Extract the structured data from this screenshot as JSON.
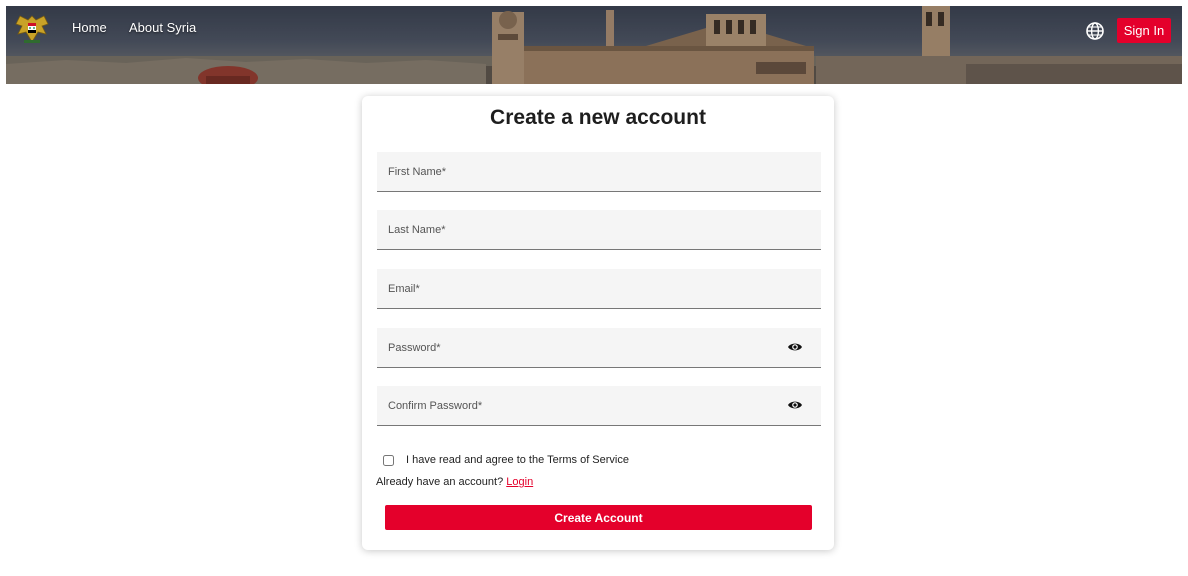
{
  "colors": {
    "accent": "#e4002b",
    "header_sky": "#4d5563",
    "field_bg": "#f5f5f5"
  },
  "header": {
    "logo_icon": "syrian-eagle-emblem",
    "nav": [
      {
        "label": "Home"
      },
      {
        "label": "About Syria"
      }
    ],
    "language_icon": "globe-icon",
    "sign_in_label": "Sign In"
  },
  "form": {
    "title": "Create a new account",
    "fields": {
      "first_name": {
        "placeholder": "First Name*",
        "value": ""
      },
      "last_name": {
        "placeholder": "Last Name*",
        "value": ""
      },
      "email": {
        "placeholder": "Email*",
        "value": ""
      },
      "password": {
        "placeholder": "Password*",
        "value": "",
        "icon": "eye-icon"
      },
      "confirm_password": {
        "placeholder": "Confirm Password*",
        "value": "",
        "icon": "eye-icon"
      }
    },
    "terms": {
      "label": "I have read and agree to the Terms of Service",
      "checked": false
    },
    "login_prompt": "Already have an account?",
    "login_link": "Login",
    "submit_label": "Create Account"
  }
}
